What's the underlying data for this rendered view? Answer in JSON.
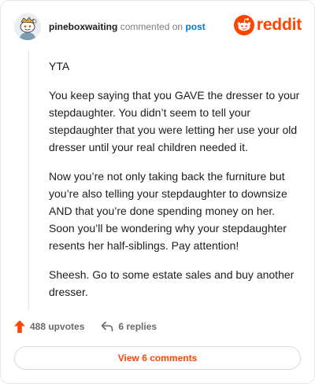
{
  "header": {
    "username": "pineboxwaiting",
    "verb": "commented on",
    "post_link": "post",
    "brand": "reddit",
    "brand_color": "#ff4500",
    "link_color": "#0079d3"
  },
  "comment": {
    "paragraphs": [
      "YTA",
      "You keep saying that you GAVE the dresser to your stepdaughter. You didn’t seem to tell your stepdaughter that you were letting her use your old dresser until your real children needed it.",
      "Now you’re not only taking back the furniture but you’re also telling your stepdaughter to downsize AND that you’re done spending money on her. Soon you’ll be wondering why your stepdaughter resents her half-siblings. Pay attention!",
      "Sheesh. Go to some estate sales and buy another dresser."
    ]
  },
  "actions": {
    "upvotes_label": "488 upvotes",
    "replies_label": "6 replies",
    "view_comments_label": "View 6 comments"
  },
  "icons": {
    "avatar": "snoo-avatar-icon",
    "brand_mark": "reddit-alien-icon",
    "upvote": "upvote-arrow-icon",
    "reply": "reply-arrow-icon"
  }
}
